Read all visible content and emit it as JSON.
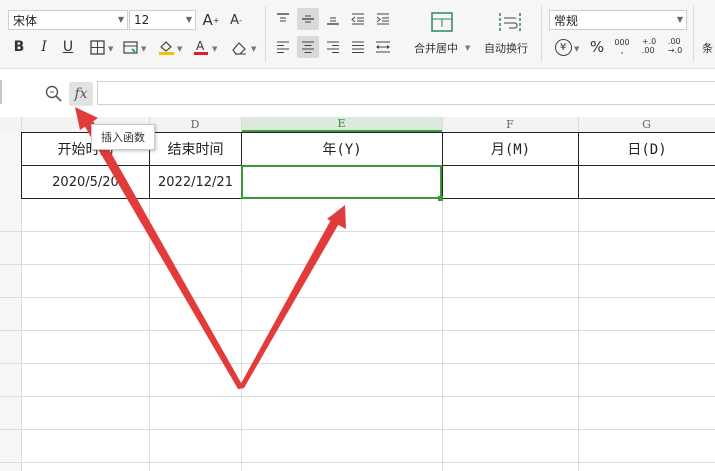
{
  "ribbon": {
    "font_name": "宋体",
    "font_size": "12",
    "merge_center_label": "合并居中",
    "wrap_text_label": "自动换行",
    "number_format": "常规",
    "currency_symbol": "¥",
    "percent_symbol": "%",
    "thousands_label": "000",
    "increase_decimal_label": "+.0\n.00",
    "decrease_decimal_label": ".00\n→.0",
    "cut_off_label": "条"
  },
  "formula_bar": {
    "fx_label": "fx",
    "tooltip": "插入函数",
    "formula_value": ""
  },
  "grid": {
    "column_headers": [
      "D",
      "E",
      "F",
      "G"
    ],
    "selected_column": "E",
    "header_row": [
      "开始时间",
      "结束时间",
      "年(Y)",
      "月(M)",
      "日(D)"
    ],
    "data_row": [
      "2020/5/20",
      "2022/12/21",
      "",
      "",
      ""
    ]
  },
  "colors": {
    "selection_green": "#3a9a3a",
    "arrow_red": "#e23b3b"
  }
}
